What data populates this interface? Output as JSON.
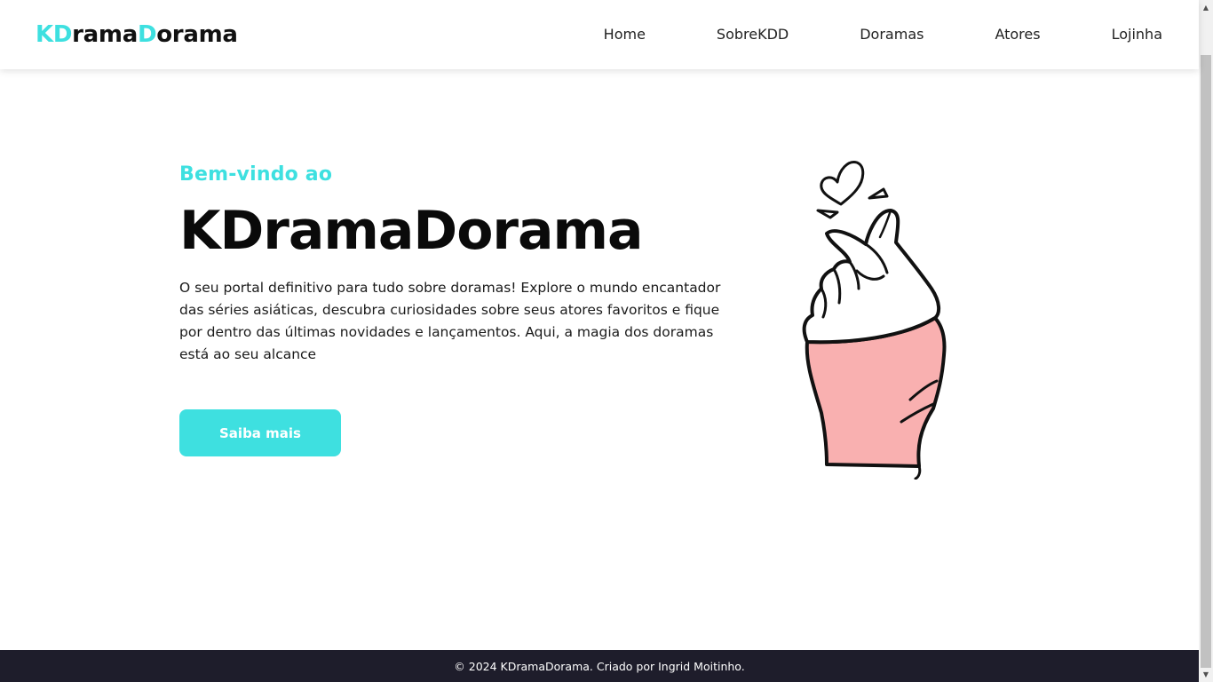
{
  "header": {
    "logo": {
      "part1": "KD",
      "part2": "rama",
      "part3": "D",
      "part4": "orama"
    },
    "nav": [
      "Home",
      "SobreKDD",
      "Doramas",
      "Atores",
      "Lojinha"
    ]
  },
  "hero": {
    "subtitle": "Bem-vindo ao",
    "title": "KDramaDorama",
    "description": "O seu portal definitivo para tudo sobre doramas! Explore o mundo encantador das séries asiáticas, descubra curiosidades sobre seus atores favoritos e fique por dentro das últimas novidades e lançamentos. Aqui, a magia dos doramas está ao seu alcance",
    "button": "Saiba mais",
    "illustration_icon": "finger-heart-hand-icon"
  },
  "footer": {
    "text": "© 2024 KDramaDorama. Criado por Ingrid Moitinho."
  },
  "colors": {
    "accent": "#3ee0e0",
    "footer_bg": "#1e1d2b",
    "sleeve": "#f9b0b0"
  }
}
